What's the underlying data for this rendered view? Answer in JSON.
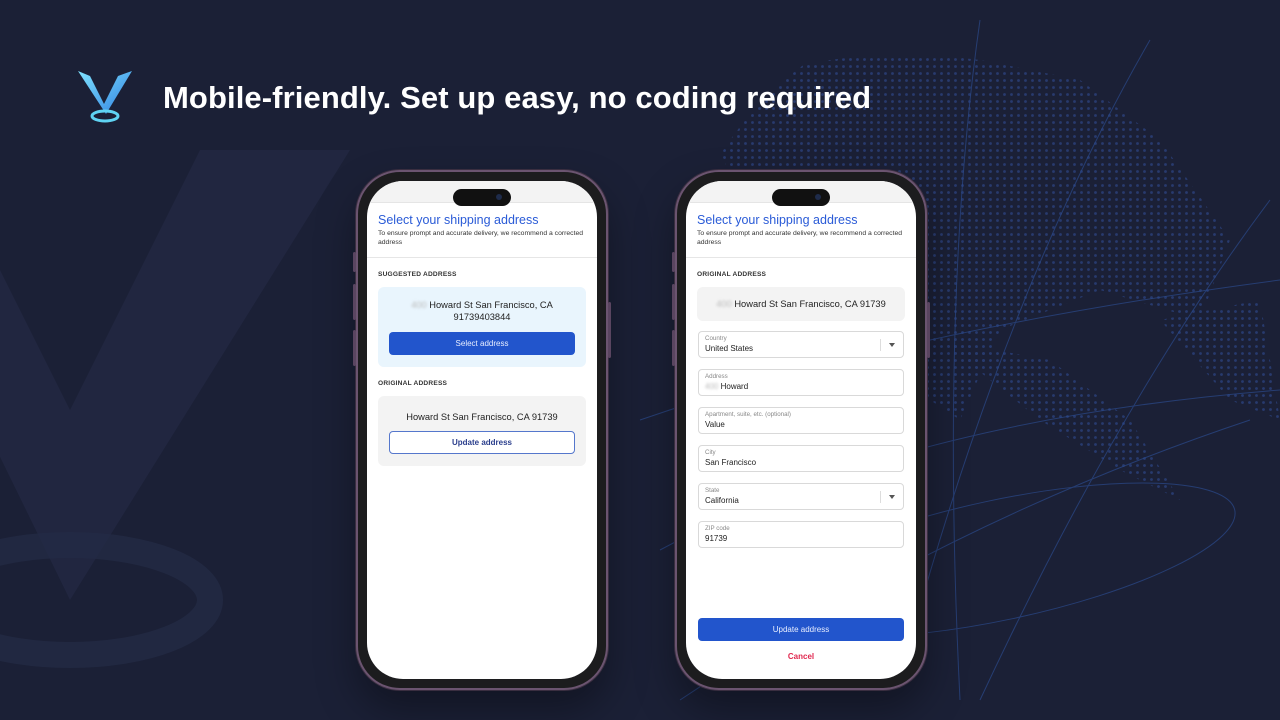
{
  "headline": "Mobile-friendly. Set up easy, no coding required",
  "logo": {
    "icon": "v-pin-logo-icon",
    "colors": [
      "#5fd3f3",
      "#3a7bd5"
    ]
  },
  "phone_left": {
    "title": "Select your shipping address",
    "subtitle": "To ensure prompt and accurate delivery, we recommend a corrected address",
    "suggested": {
      "label": "SUGGESTED ADDRESS",
      "address_number_blurred": "400",
      "address_line1": "Howard St San Francisco, CA",
      "address_line2": "91739403844",
      "button": "Select address"
    },
    "original": {
      "label": "ORIGINAL ADDRESS",
      "address": "Howard St San Francisco, CA 91739",
      "button": "Update address"
    }
  },
  "phone_right": {
    "title": "Select your shipping address",
    "subtitle": "To ensure prompt and accurate delivery, we recommend a corrected address",
    "original": {
      "label": "ORIGINAL ADDRESS",
      "address_number_blurred": "400",
      "address": "Howard St San Francisco, CA 91739"
    },
    "form": {
      "country": {
        "label": "Country",
        "value": "United States"
      },
      "address": {
        "label": "Address",
        "value_blurred": "400",
        "value": "Howard"
      },
      "apartment": {
        "label": "Apartment, suite, etc. (optional)",
        "value": "Value"
      },
      "city": {
        "label": "City",
        "value": "San Francisco"
      },
      "state": {
        "label": "State",
        "value": "California"
      },
      "zip": {
        "label": "ZIP code",
        "value": "91739"
      }
    },
    "update_button": "Update address",
    "cancel": "Cancel"
  },
  "colors": {
    "background": "#1b2036",
    "accent_blue": "#2255cc",
    "title_blue": "#2a5bd7",
    "cancel_red": "#e0284f",
    "suggested_card": "#e9f5fd"
  }
}
